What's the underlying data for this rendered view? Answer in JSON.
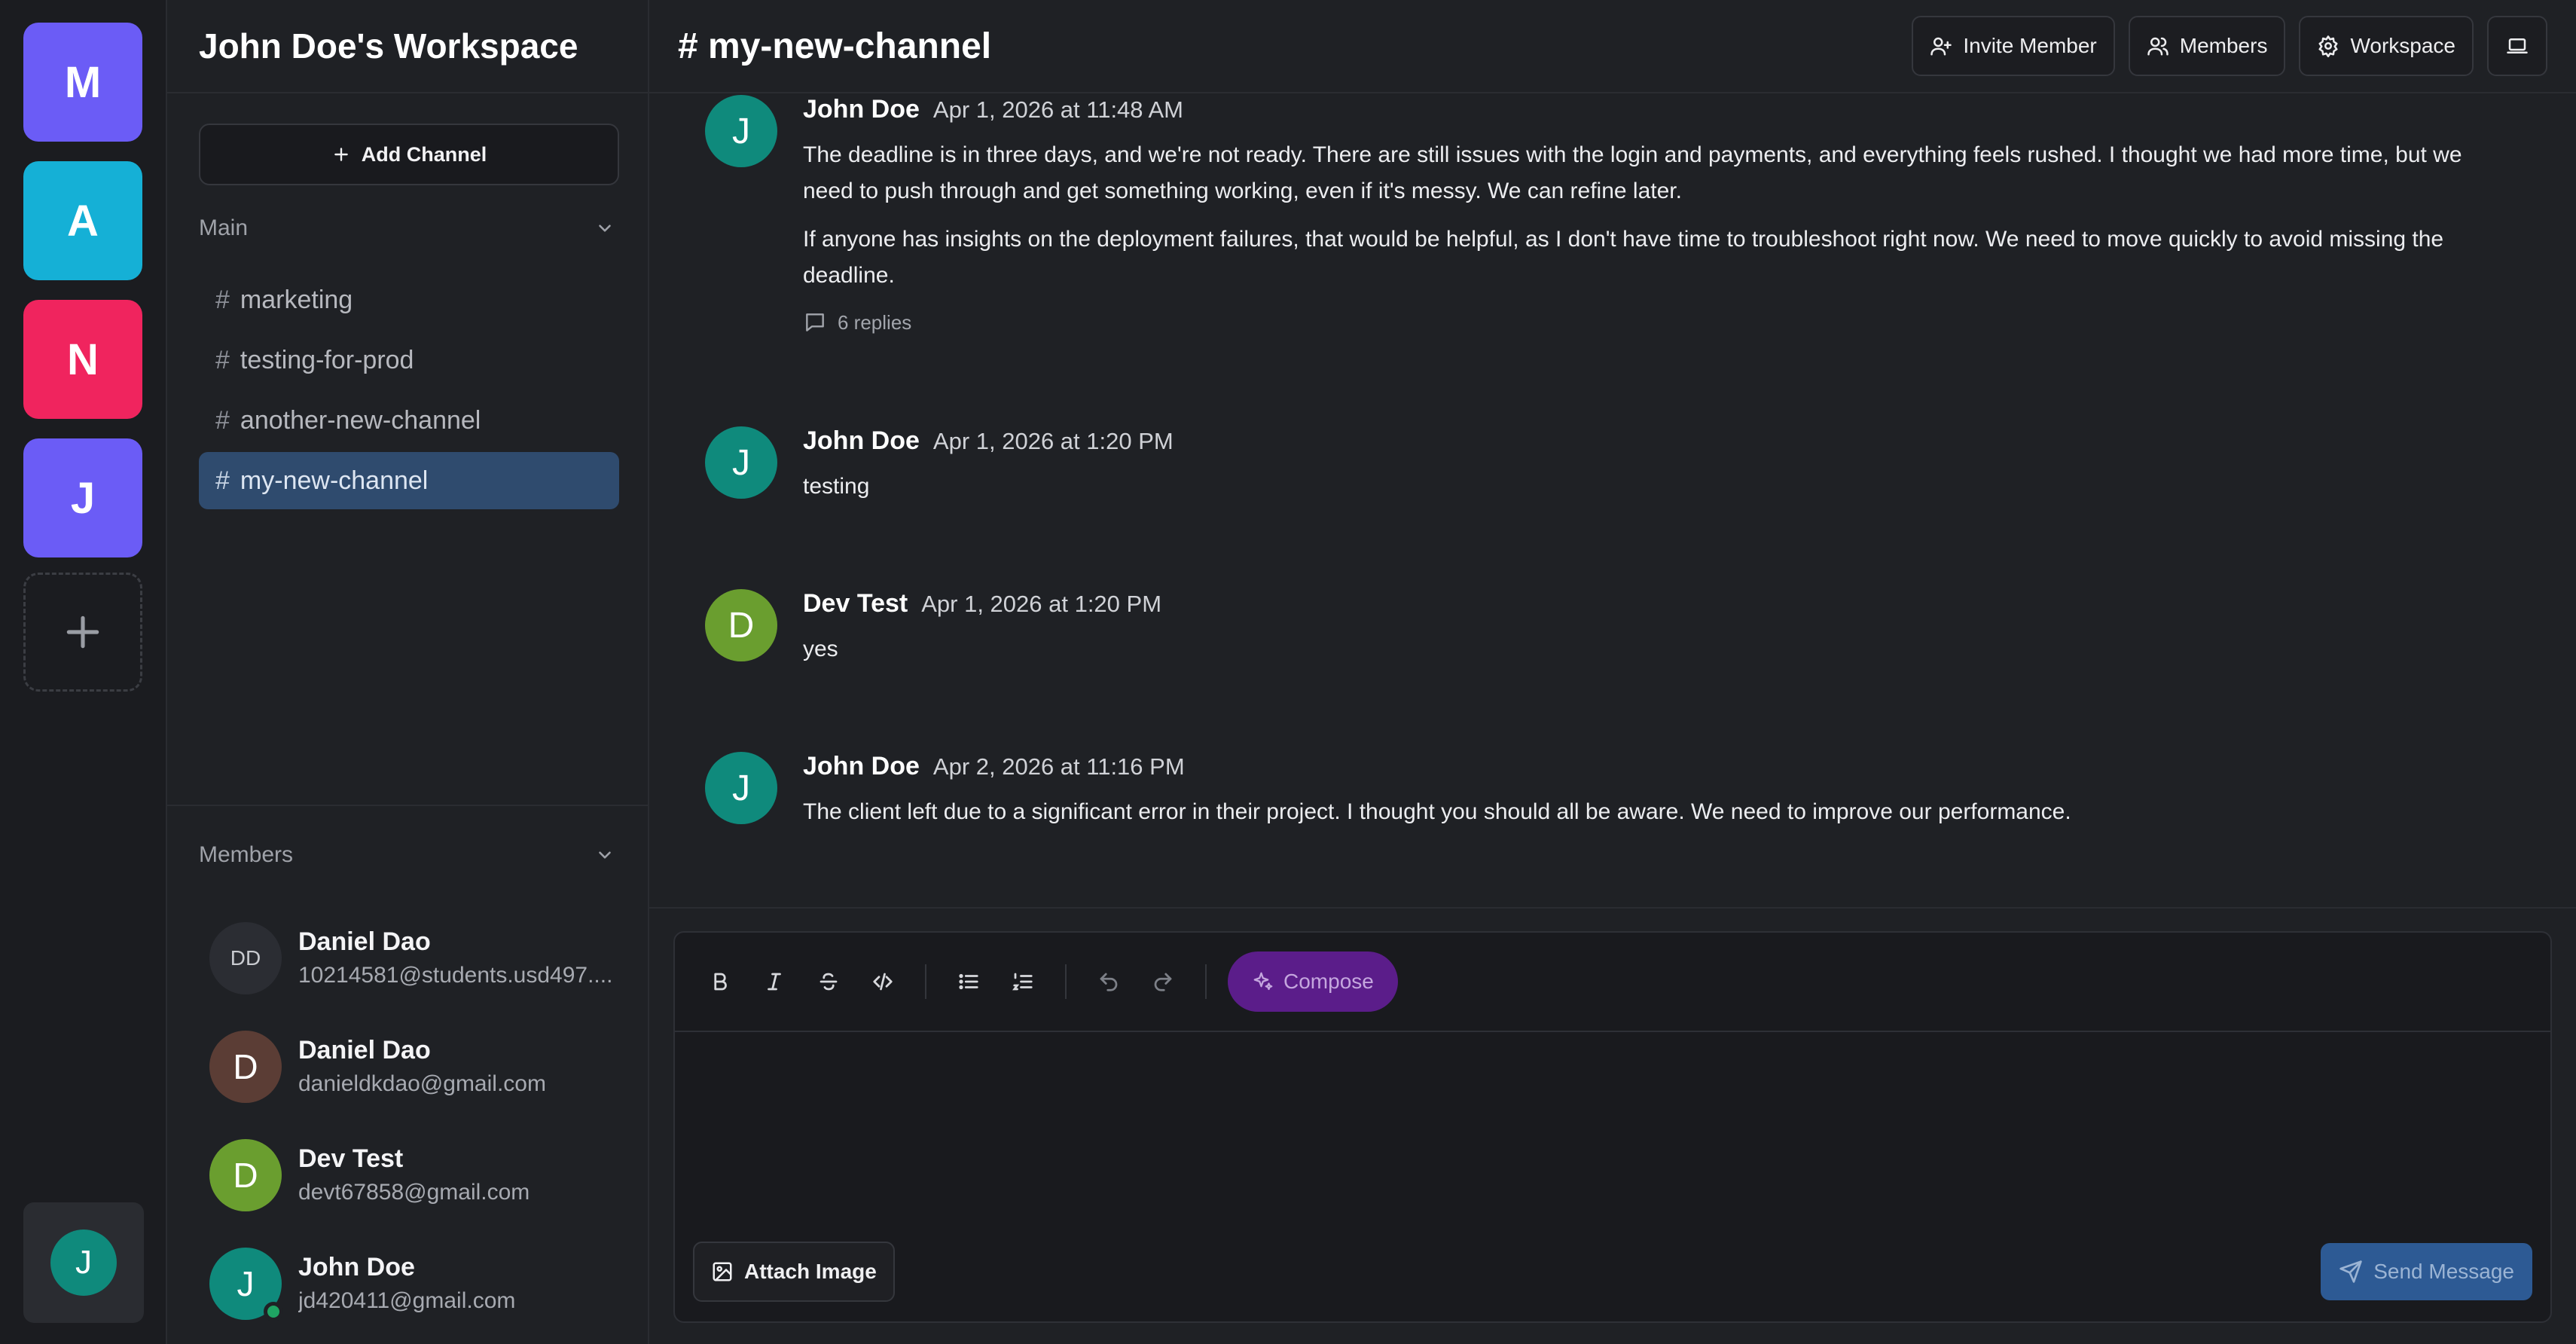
{
  "workspaces": [
    {
      "letter": "M",
      "color": "#6b5cf6"
    },
    {
      "letter": "A",
      "color": "#15b0d6"
    },
    {
      "letter": "N",
      "color": "#f0245e"
    },
    {
      "letter": "J",
      "color": "#6b5cf6"
    }
  ],
  "rail_user": {
    "initial": "J",
    "color": "#0f8a7c"
  },
  "sidebar": {
    "workspace_name": "John Doe's Workspace",
    "add_channel_label": "Add Channel",
    "section_main": "Main",
    "channels": [
      {
        "name": "marketing",
        "active": false
      },
      {
        "name": "testing-for-prod",
        "active": false
      },
      {
        "name": "another-new-channel",
        "active": false
      },
      {
        "name": "my-new-channel",
        "active": true
      }
    ],
    "section_members": "Members",
    "members": [
      {
        "initials": "DD",
        "name": "Daniel Dao",
        "email": "10214581@students.usd497....",
        "color": "#2b2d33",
        "online": false
      },
      {
        "initials": "D",
        "name": "Daniel Dao",
        "email": "danieldkdao@gmail.com",
        "color": "#5b3d35",
        "online": false
      },
      {
        "initials": "D",
        "name": "Dev Test",
        "email": "devt67858@gmail.com",
        "color": "#6a9e2f",
        "online": false
      },
      {
        "initials": "J",
        "name": "John Doe",
        "email": "jd420411@gmail.com",
        "color": "#0f8a7c",
        "online": true
      }
    ]
  },
  "header": {
    "channel_title": "# my-new-channel",
    "invite_label": "Invite Member",
    "members_label": "Members",
    "workspace_label": "Workspace"
  },
  "messages": [
    {
      "initial": "J",
      "color": "#0f8a7c",
      "author": "John Doe",
      "time": "Apr 1, 2026 at 11:48 AM",
      "paragraphs": [
        "The deadline is in three days, and we're not ready. There are still issues with the login and payments, and everything feels rushed. I thought we had more time, but we need to push through and get something working, even if it's messy. We can refine later.",
        "If anyone has insights on the deployment failures, that would be helpful, as I don't have time to troubleshoot right now. We need to move quickly to avoid missing the deadline."
      ],
      "replies": "6 replies"
    },
    {
      "initial": "J",
      "color": "#0f8a7c",
      "author": "John Doe",
      "time": "Apr 1, 2026 at 1:20 PM",
      "paragraphs": [
        "testing"
      ]
    },
    {
      "initial": "D",
      "color": "#6a9e2f",
      "author": "Dev Test",
      "time": "Apr 1, 2026 at 1:20 PM",
      "paragraphs": [
        "yes"
      ]
    },
    {
      "initial": "J",
      "color": "#0f8a7c",
      "author": "John Doe",
      "time": "Apr 2, 2026 at 11:16 PM",
      "paragraphs": [
        "The client left due to a significant error in their project. I thought you should all be aware. We need to improve our performance."
      ]
    }
  ],
  "composer": {
    "compose_label": "Compose",
    "attach_label": "Attach Image",
    "send_label": "Send Message",
    "tools": [
      "bold-icon",
      "italic-icon",
      "strikethrough-icon",
      "code-icon",
      "bullet-list-icon",
      "numbered-list-icon",
      "undo-icon",
      "redo-icon"
    ]
  },
  "colors": {
    "accent_active_channel": "#2f4b6e",
    "compose_button": "#5b1d8a",
    "send_button": "#2d5a94",
    "online": "#1fa463"
  }
}
